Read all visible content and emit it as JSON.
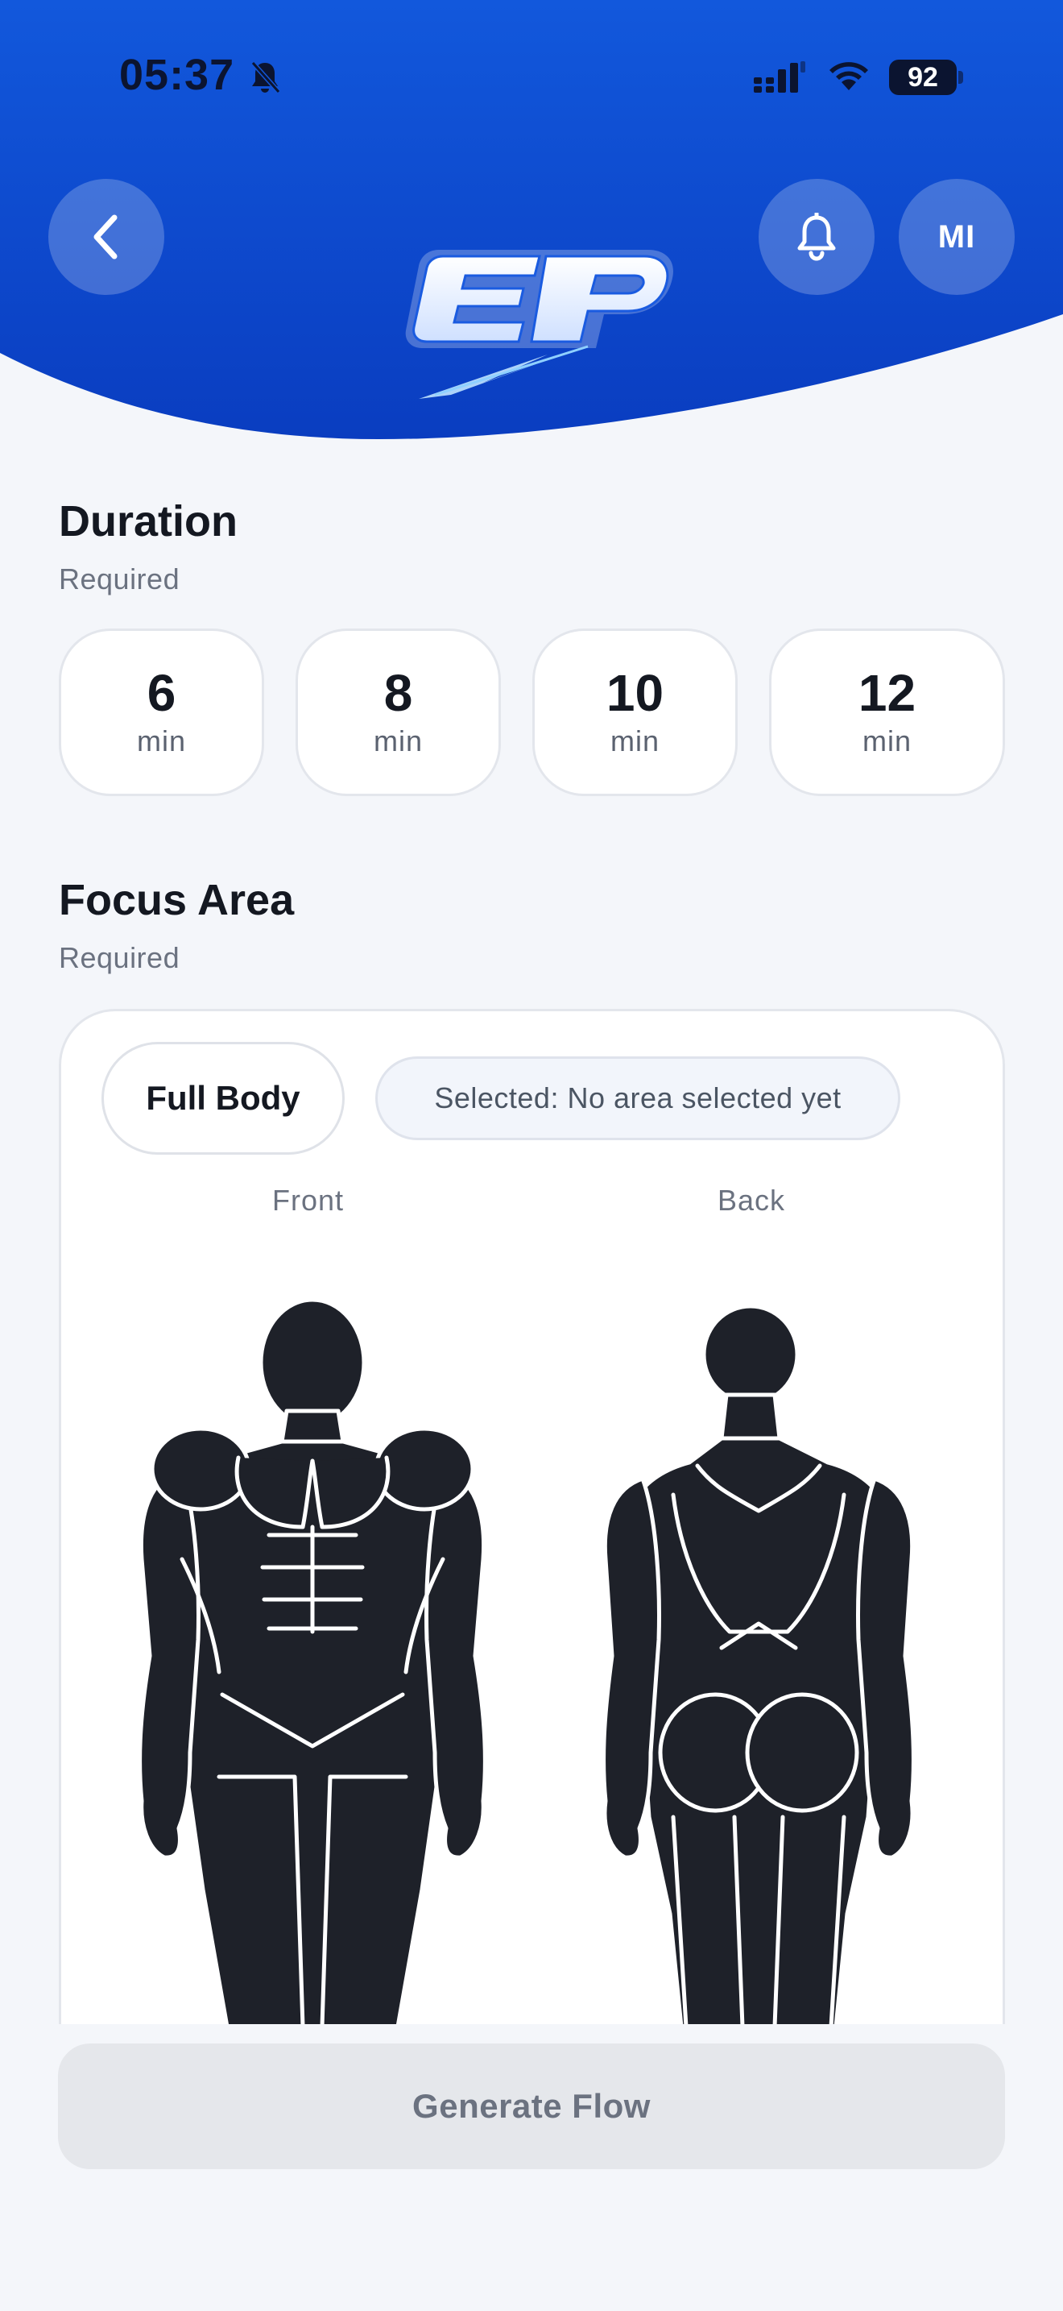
{
  "status_bar": {
    "time": "05:37",
    "battery": "92"
  },
  "header": {
    "avatar_initials": "MI",
    "logo_text": "EP"
  },
  "duration": {
    "title": "Duration",
    "subtitle": "Required",
    "options": [
      {
        "value": "6",
        "unit": "min"
      },
      {
        "value": "8",
        "unit": "min"
      },
      {
        "value": "10",
        "unit": "min"
      },
      {
        "value": "12",
        "unit": "min"
      }
    ]
  },
  "focus_area": {
    "title": "Focus Area",
    "subtitle": "Required",
    "full_body_label": "Full Body",
    "selected_label": "Selected: No area selected yet",
    "front_label": "Front",
    "back_label": "Back"
  },
  "generate_label": "Generate Flow",
  "colors": {
    "accent": "#1052d6",
    "header_dark": "#0a3ec2",
    "body_fill": "#1e2129",
    "disabled_button": "#e5e7eb"
  }
}
